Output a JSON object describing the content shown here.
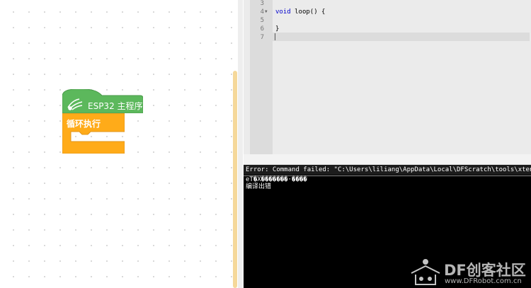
{
  "blocks": {
    "hat_label": "ESP32 主程序",
    "loop_label": "循环执行",
    "hat_color": "#5cb85c",
    "loop_color": "#ffab19"
  },
  "editor": {
    "lines": [
      {
        "num": "3",
        "text": "",
        "fold": false
      },
      {
        "num": "4",
        "keyword": "void",
        "text": " loop() {",
        "fold": true
      },
      {
        "num": "5",
        "text": "",
        "fold": false
      },
      {
        "num": "6",
        "text": "}",
        "fold": false
      },
      {
        "num": "7",
        "text": "",
        "fold": false
      }
    ]
  },
  "console": {
    "error_line": "Error: Command failed: \"C:\\Users\\liliang\\AppData\\Local\\DFScratch\\tools\\xtensa",
    "output_line1": "eT�X�������·����",
    "output_line2": "编译出错"
  },
  "watermark": {
    "brand": "DF创客社区",
    "url": "www.DFRobot.com.cn"
  }
}
